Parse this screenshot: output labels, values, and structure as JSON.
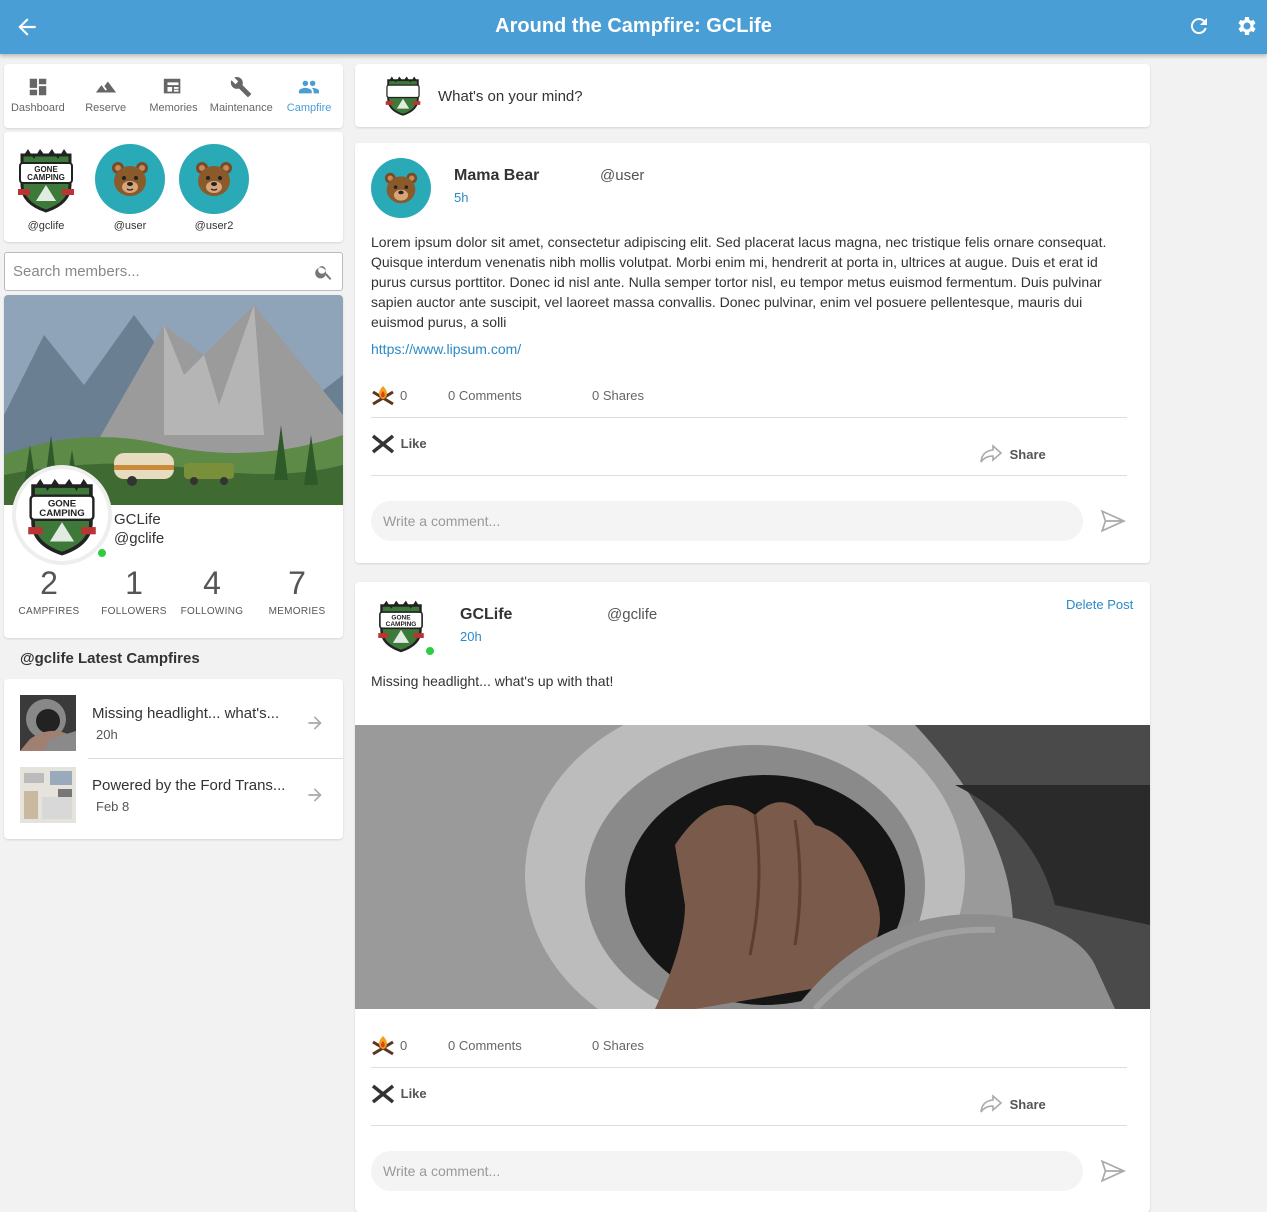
{
  "header": {
    "title": "Around the Campfire:  GCLife",
    "accent": "#4a9ed6"
  },
  "nav": {
    "items": [
      {
        "label": "Dashboard",
        "icon": "dashboard-icon"
      },
      {
        "label": "Reserve",
        "icon": "mountain-icon"
      },
      {
        "label": "Memories",
        "icon": "newspaper-icon"
      },
      {
        "label": "Maintenance",
        "icon": "wrench-icon"
      },
      {
        "label": "Campfire",
        "icon": "people-icon",
        "active": true
      }
    ]
  },
  "members": [
    {
      "handle": "@gclife"
    },
    {
      "handle": "@user"
    },
    {
      "handle": "@user2"
    }
  ],
  "search": {
    "placeholder": "Search members..."
  },
  "profile": {
    "name": "GCLife",
    "handle": "@gclife",
    "stats": [
      {
        "value": "2",
        "label": "CAMPFIRES"
      },
      {
        "value": "1",
        "label": "FOLLOWERS"
      },
      {
        "value": "4",
        "label": "FOLLOWING"
      },
      {
        "value": "7",
        "label": "MEMORIES"
      }
    ]
  },
  "latest": {
    "title": "@gclife Latest Campfires",
    "items": [
      {
        "title": "Missing headlight... what's...",
        "time": "20h"
      },
      {
        "title": "Powered by the Ford Trans...",
        "time": "Feb 8"
      }
    ]
  },
  "composer": {
    "placeholder": "What's on your mind?"
  },
  "posts": [
    {
      "name": "Mama Bear",
      "handle": "@user",
      "time": "5h",
      "body": "Lorem ipsum dolor sit amet, consectetur adipiscing elit. Sed placerat lacus magna, nec tristique felis ornare consequat. Quisque interdum venenatis nibh mollis volutpat. Morbi enim mi, hendrerit at porta in, ultrices at augue. Duis et erat id purus cursus porttitor. Donec id nisl ante. Nulla semper tortor nisl, eu tempor metus euismod fermentum. Duis pulvinar sapien auctor ante suscipit, vel laoreet massa convallis. Donec pulvinar, enim vel posuere pellentesque, mauris dui euismod purus, a solli",
      "link": "https://www.lipsum.com/",
      "reactions": "0",
      "comments": "0 Comments",
      "shares": "0 Shares",
      "like_label": "Like",
      "share_label": "Share",
      "comment_placeholder": "Write a comment..."
    },
    {
      "name": "GCLife",
      "handle": "@gclife",
      "time": "20h",
      "delete_label": "Delete Post",
      "body": "Missing headlight...  what's up with that!",
      "reactions": "0",
      "comments": "0 Comments",
      "shares": "0 Shares",
      "like_label": "Like",
      "share_label": "Share",
      "comment_placeholder": "Write a comment..."
    }
  ]
}
